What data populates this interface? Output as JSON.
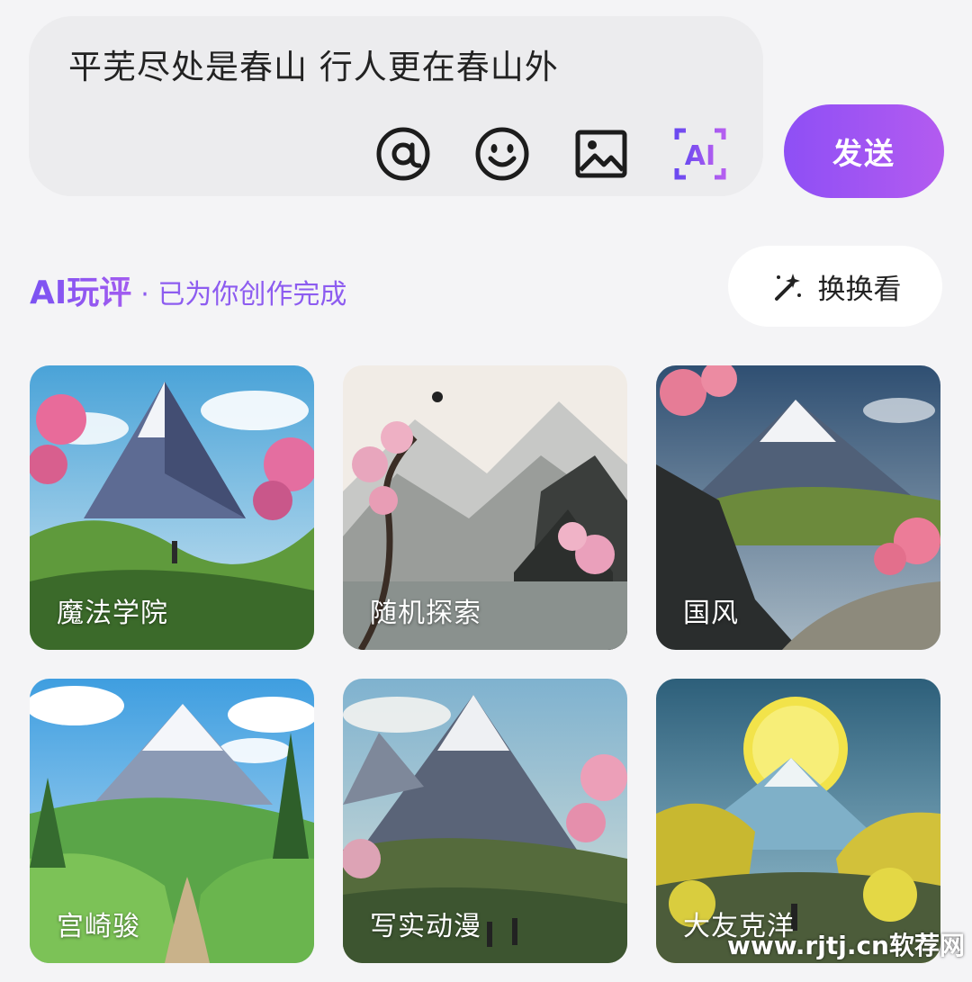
{
  "compose": {
    "text": "平芜尽处是春山 行人更在春山外",
    "tools": [
      "at-icon",
      "emoji-icon",
      "image-icon",
      "ai-icon"
    ],
    "ai_icon_text": "AI"
  },
  "send_label": "发送",
  "section": {
    "title": "AI玩评",
    "subtitle": "· 已为你创作完成",
    "swap_label": "换换看"
  },
  "styles": [
    {
      "label": "魔法学院"
    },
    {
      "label": "随机探索"
    },
    {
      "label": "国风"
    },
    {
      "label": "宫崎骏"
    },
    {
      "label": "写实动漫"
    },
    {
      "label": "大友克洋"
    }
  ],
  "watermark": "www.rjtj.cn软荐网",
  "colors": {
    "accent": "#8e4ff5",
    "accent2": "#b35bf0"
  }
}
